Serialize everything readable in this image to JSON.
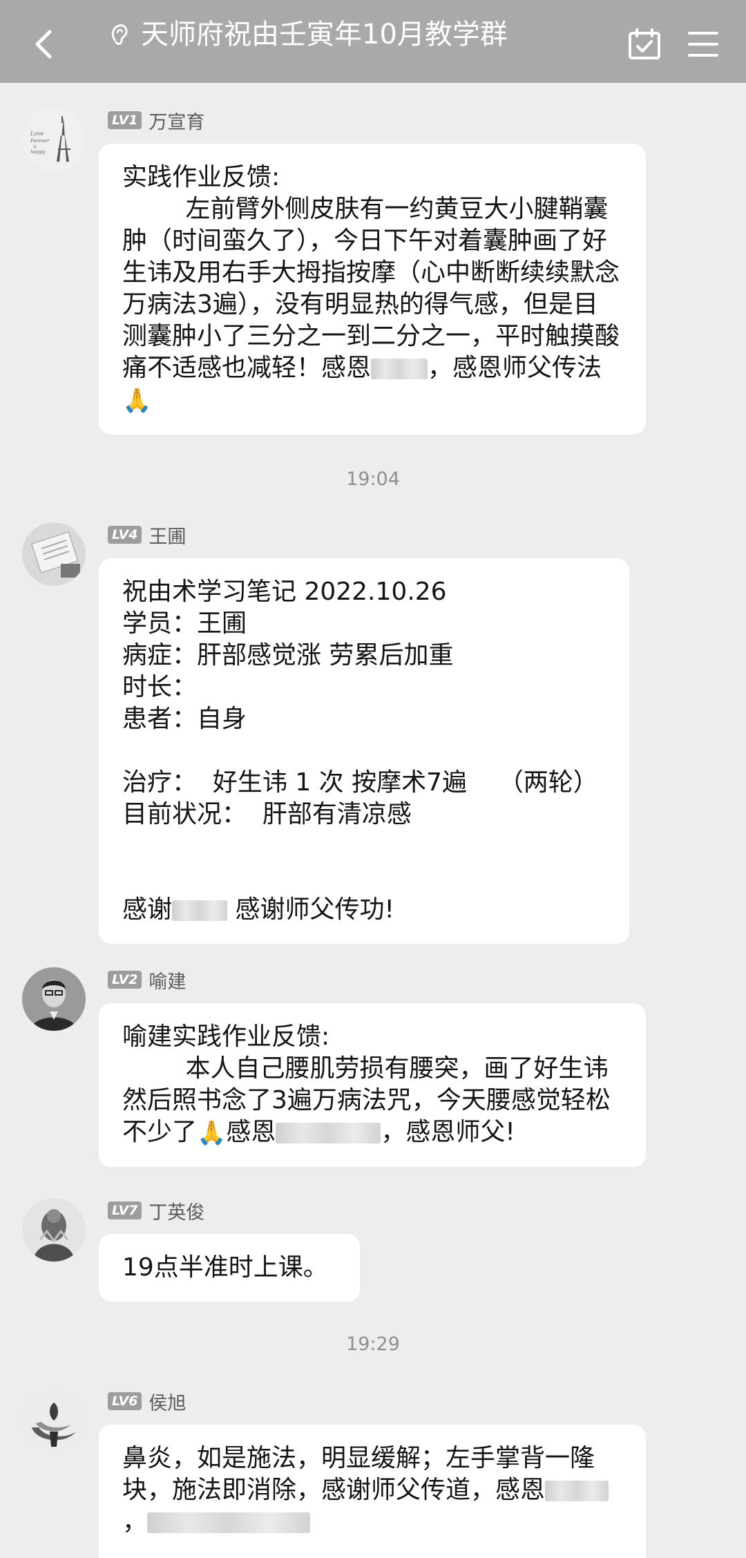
{
  "header": {
    "title": "天师府祝由壬寅年10月教学群"
  },
  "messages": [
    {
      "level": "LV1",
      "name": "万宣育",
      "text_1": "实践作业反馈:\n        左前臂外侧皮肤有一约黄豆大小腱鞘囊肿（时间蛮久了），今日下午对着囊肿画了好生讳及用右手大拇指按摩（心中断断续续默念万病法3遍），没有明显热的得气感，但是目测囊肿小了三分之一到二分之一，平时触摸酸痛不适感也减轻！感恩",
      "text_2": "，感恩师父传法",
      "emoji": "🙏"
    },
    {
      "level": "LV4",
      "name": "王圃",
      "text_1": "祝由术学习笔记 2022.10.26\n学员：王圃\n病症：肝部感觉涨 劳累后加重\n时长：\n患者：自身\n\n治疗：  好生讳 1 次 按摩术7遍    （两轮）\n目前状况：  肝部有清凉感\n\n\n感谢",
      "text_2": " 感谢师父传功!"
    },
    {
      "level": "LV2",
      "name": "喻建",
      "text_1": "喻建实践作业反馈:\n        本人自己腰肌劳损有腰突，画了好生讳然后照书念了3遍万病法咒，今天腰感觉轻松不少了",
      "emoji": "🙏",
      "text_2": "感恩",
      "text_3": "，感恩师父!"
    },
    {
      "level": "LV7",
      "name": "丁英俊",
      "text_1": "19点半准时上课。"
    },
    {
      "level": "LV6",
      "name": "侯旭",
      "text_1": "鼻炎，如是施法，明显缓解；左手掌背一隆块，施法即消除，感谢师父传道，感恩",
      "text_2": "，"
    }
  ],
  "timestamps": [
    "19:04",
    "19:29"
  ],
  "avatar_1_text": "Love Forever is happy",
  "colors": {
    "header_bg": "#a9a9a9",
    "chat_bg": "#ededed",
    "bubble_bg": "#ffffff",
    "badge_bg": "#9d9d9d"
  },
  "icons": [
    "back-arrow-icon",
    "ear-icon",
    "calendar-check-icon",
    "menu-icon"
  ]
}
